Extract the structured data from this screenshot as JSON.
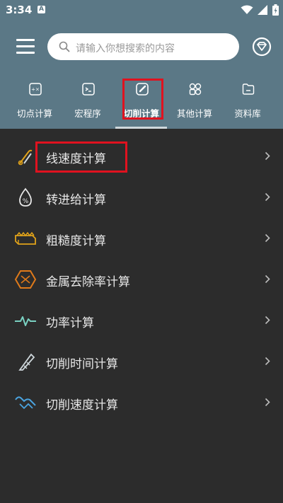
{
  "status_bar": {
    "time": "3:34",
    "notification_icon": "A"
  },
  "search": {
    "placeholder": "请输入你想搜索的内容"
  },
  "tabs": [
    {
      "label": "切点计算",
      "icon": "calculator-icon"
    },
    {
      "label": "宏程序",
      "icon": "terminal-icon"
    },
    {
      "label": "切削计算",
      "icon": "edit-icon",
      "active": true
    },
    {
      "label": "其他计算",
      "icon": "grid-icon"
    },
    {
      "label": "资料库",
      "icon": "folder-icon"
    }
  ],
  "list": [
    {
      "label": "线速度计算",
      "icon": "tools-icon"
    },
    {
      "label": "转进给计算",
      "icon": "drop-percent-icon"
    },
    {
      "label": "粗糙度计算",
      "icon": "surface-block-icon"
    },
    {
      "label": "金属去除率计算",
      "icon": "hexagon-icon"
    },
    {
      "label": "功率计算",
      "icon": "pulse-icon"
    },
    {
      "label": "切削时间计算",
      "icon": "blade-icon"
    },
    {
      "label": "切削速度计算",
      "icon": "speed-hands-icon"
    }
  ],
  "colors": {
    "header": "#5b7886",
    "background": "#2c2c2c",
    "highlight": "#e0121f"
  }
}
